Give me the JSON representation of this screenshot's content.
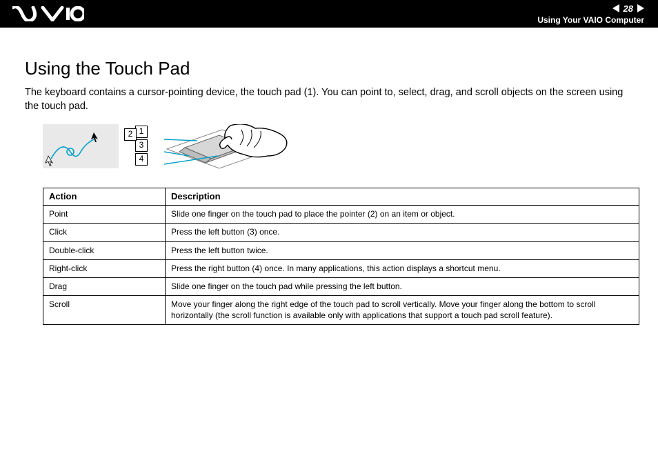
{
  "header": {
    "pageNumber": "28",
    "chapter": "Using Your VAIO Computer"
  },
  "title": "Using the Touch Pad",
  "intro": "The keyboard contains a cursor-pointing device, the touch pad (1). You can point to, select, drag, and scroll objects on the screen using the touch pad.",
  "callouts": {
    "c1": "1",
    "c2": "2",
    "c3": "3",
    "c4": "4"
  },
  "table": {
    "headers": {
      "action": "Action",
      "description": "Description"
    },
    "rows": [
      {
        "action": "Point",
        "description": "Slide one finger on the touch pad to place the pointer (2) on an item or object."
      },
      {
        "action": "Click",
        "description": "Press the left button (3) once."
      },
      {
        "action": "Double-click",
        "description": "Press the left button twice."
      },
      {
        "action": "Right-click",
        "description": "Press the right button (4) once. In many applications, this action displays a shortcut menu."
      },
      {
        "action": "Drag",
        "description": "Slide one finger on the touch pad while pressing the left button."
      },
      {
        "action": "Scroll",
        "description": "Move your finger along the right edge of the touch pad to scroll vertically. Move your finger along the bottom to scroll horizontally (the scroll function is available only with applications that support a touch pad scroll feature)."
      }
    ]
  }
}
